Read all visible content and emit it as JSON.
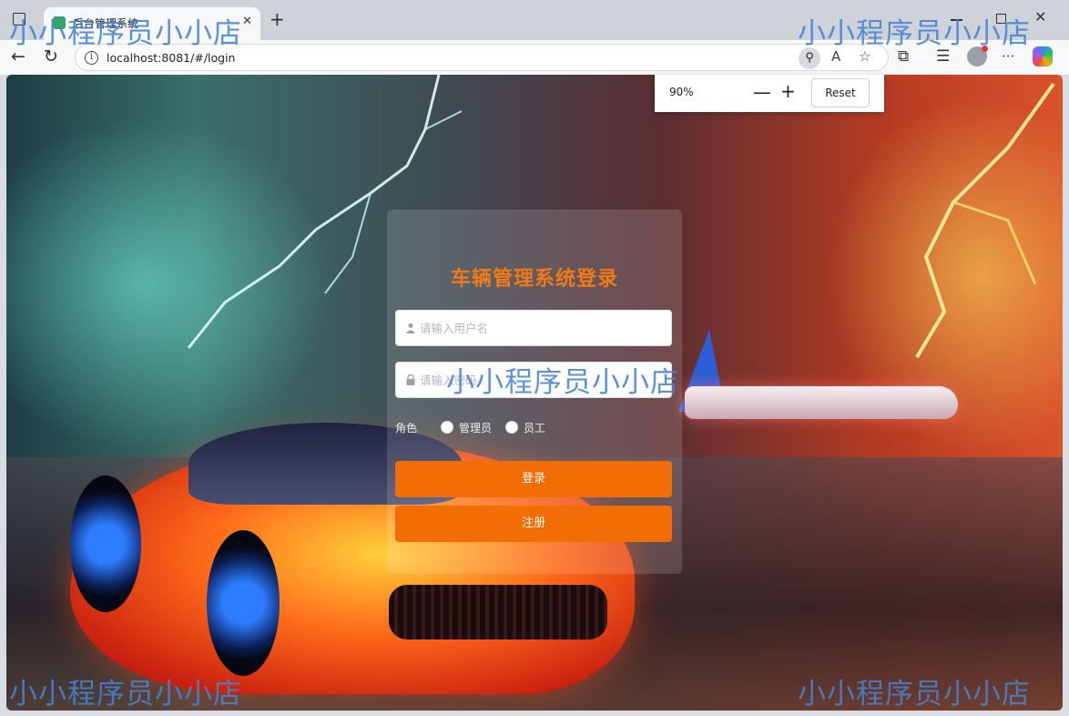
{
  "browser": {
    "tab_title": "后台管理系统",
    "tab_close": "✕",
    "new_tab": "+",
    "url": "localhost:8081/#/login",
    "back": "←",
    "reload": "↻",
    "more": "···"
  },
  "zoom": {
    "value": "90%",
    "minus": "—",
    "plus": "+",
    "reset_label": "Reset"
  },
  "login": {
    "title": "车辆管理系统登录",
    "username_placeholder": "请输入用户名",
    "password_placeholder": "请输入密码",
    "role_label": "角色",
    "roles": [
      {
        "label": "管理员"
      },
      {
        "label": "员工"
      }
    ],
    "login_button": "登录",
    "register_button": "注册"
  },
  "watermark": "小小程序员小小店",
  "colors": {
    "title": "#f07a1a",
    "button": "#f26d06",
    "watermark": "#4682d2"
  }
}
